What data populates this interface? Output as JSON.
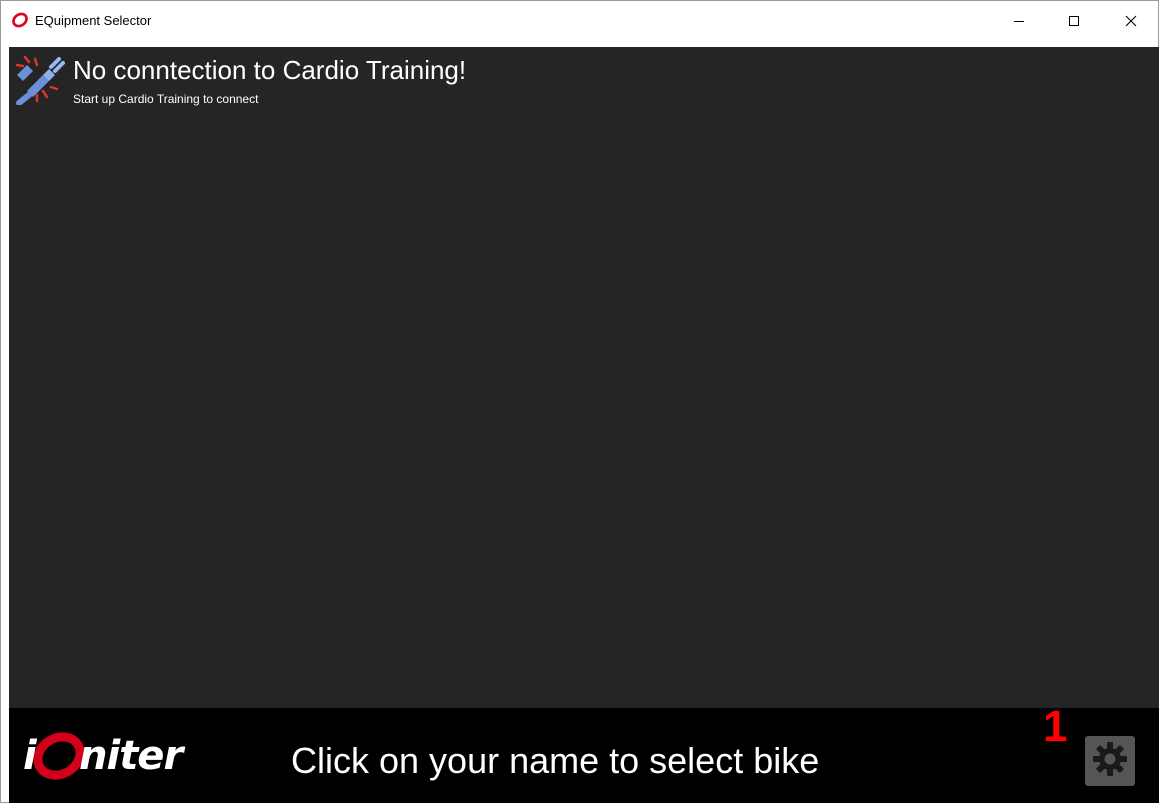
{
  "window": {
    "title": "EQuipment Selector"
  },
  "status": {
    "icon": "disconnected-plug-icon",
    "title": "No conntection to Cardio Training!",
    "subtitle": "Start up Cardio Training to connect"
  },
  "footer": {
    "logo_name": "iQniter",
    "logo_letter_i": "i",
    "logo_rest": "niter",
    "message": "Click on your name to select bike",
    "badge_number": "1",
    "settings_icon": "gear-icon"
  },
  "colors": {
    "content_background": "#252525",
    "footer_background": "#000000",
    "badge_color": "#ff0000",
    "logo_accent": "#d3001b"
  }
}
